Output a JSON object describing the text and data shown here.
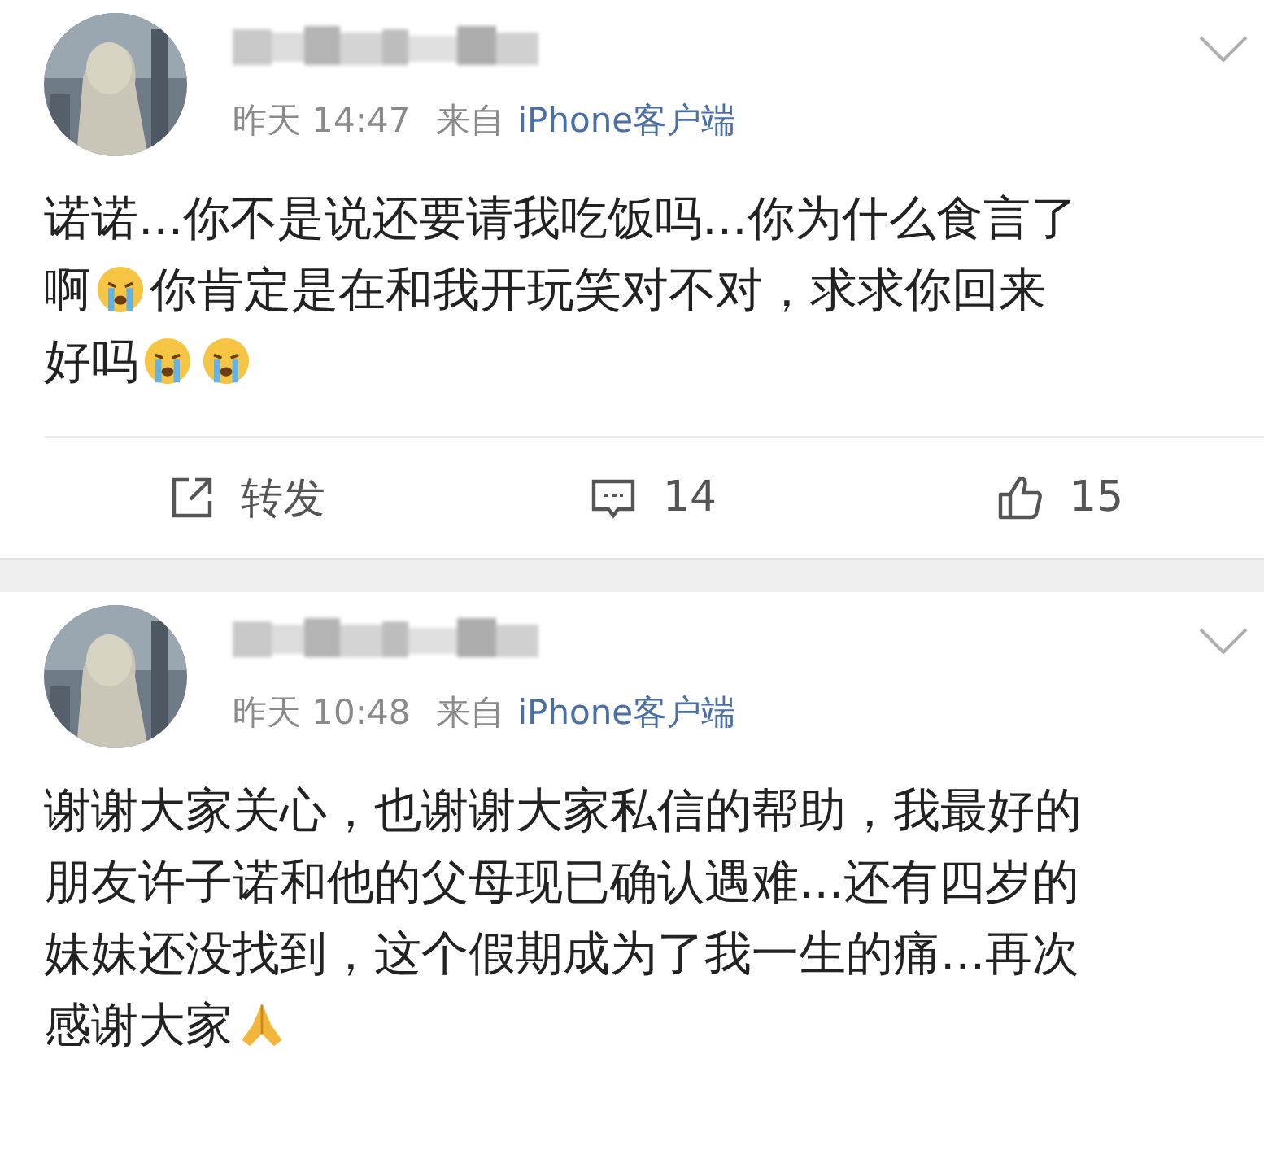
{
  "posts": [
    {
      "time": "昨天 14:47",
      "source_prefix": "来自",
      "source": "iPhone客户端",
      "lines": [
        [
          {
            "kind": "text",
            "text": "诺诺...你不是说还要请我吃饭吗...你为什么食言了"
          }
        ],
        [
          {
            "kind": "text",
            "text": "啊"
          },
          {
            "kind": "crying"
          },
          {
            "kind": "text",
            "text": "你肯定是在和我开玩笑对不对，求求你回来"
          }
        ],
        [
          {
            "kind": "text",
            "text": "好吗"
          },
          {
            "kind": "crying"
          },
          {
            "kind": "crying"
          }
        ]
      ],
      "actions": [
        {
          "kind": "repost",
          "label": "转发"
        },
        {
          "kind": "comment",
          "label": "14"
        },
        {
          "kind": "like",
          "label": "15"
        }
      ]
    },
    {
      "time": "昨天 10:48",
      "source_prefix": "来自",
      "source": "iPhone客户端",
      "lines": [
        [
          {
            "kind": "text",
            "text": "谢谢大家关心，也谢谢大家私信的帮助，我最好的"
          }
        ],
        [
          {
            "kind": "text",
            "text": "朋友许子诺和他的父母现已确认遇难...还有四岁的"
          }
        ],
        [
          {
            "kind": "text",
            "text": "妹妹还没找到，这个假期成为了我一生的痛...再次"
          }
        ],
        [
          {
            "kind": "text",
            "text": "感谢大家"
          },
          {
            "kind": "praying"
          }
        ]
      ]
    }
  ]
}
